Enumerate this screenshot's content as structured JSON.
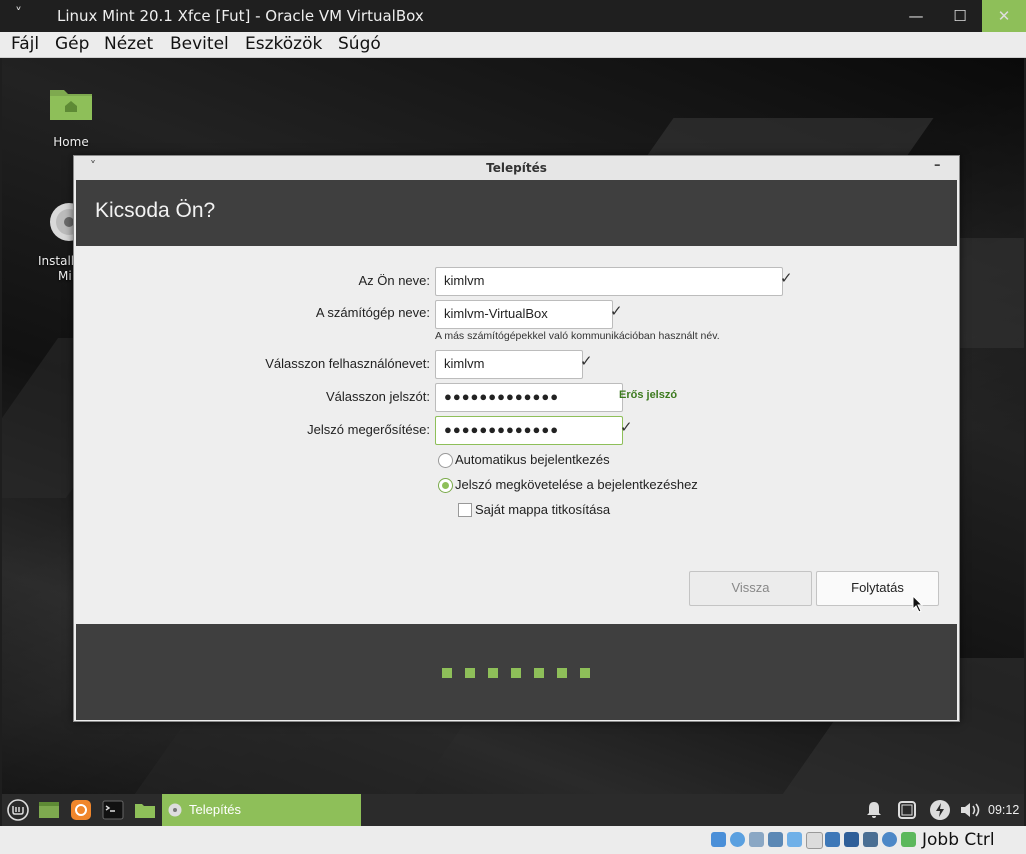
{
  "window": {
    "title": "Linux Mint 20.1 Xfce [Fut] - Oracle VM VirtualBox",
    "menu_glyph": "˅",
    "minimize": "—",
    "maximize": "☐",
    "close": "✕"
  },
  "menubar": [
    "Fájl",
    "Gép",
    "Nézet",
    "Bevitel",
    "Eszközök",
    "Súgó"
  ],
  "desktop": {
    "icons": [
      {
        "label": "Home"
      },
      {
        "label": "Install"
      },
      {
        "label": "Mi"
      }
    ]
  },
  "dialog": {
    "title": "Telepítés",
    "menu_glyph": "˅",
    "minimize_glyph": "–",
    "header": "Kicsoda Ön?",
    "fields": {
      "name": {
        "label": "Az Ön neve:",
        "value": "kimlvm"
      },
      "computer": {
        "label": "A számítógép neve:",
        "value": "kimlvm-VirtualBox",
        "hint": "A más számítógépekkel való kommunikációban használt név."
      },
      "username": {
        "label": "Válasszon felhasználónevet:",
        "value": "kimlvm"
      },
      "password": {
        "label": "Válasszon jelszót:",
        "value": "●●●●●●●●●●●●●",
        "strength": "Erős jelszó"
      },
      "confirm": {
        "label": "Jelszó megerősítése:",
        "value": "●●●●●●●●●●●●●"
      }
    },
    "check_glyph": "✓",
    "options": {
      "auto_login": {
        "label": "Automatikus bejelentkezés",
        "selected": false
      },
      "require_password": {
        "label": "Jelszó megkövetelése a bejelentkezéshez",
        "selected": true
      },
      "encrypt_home": {
        "label": "Saját mappa titkosítása",
        "checked": false
      }
    },
    "buttons": {
      "back": "Vissza",
      "continue": "Folytatás"
    },
    "progress_steps": 7
  },
  "taskbar": {
    "active_task": "Telepítés",
    "clock": "09:12"
  },
  "statusbar": {
    "host_key": "Jobb Ctrl"
  },
  "colors": {
    "accent": "#8ebf59",
    "dark_panel": "#3f3f3f",
    "strength_text": "#3c7a1e"
  }
}
